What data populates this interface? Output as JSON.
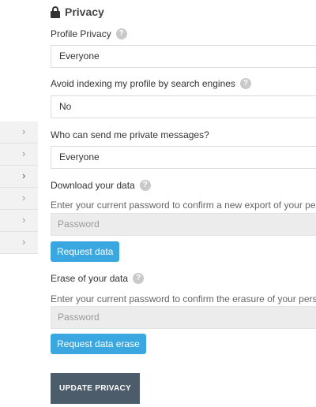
{
  "section": {
    "title": "Privacy",
    "icon": "lock-icon"
  },
  "profile_privacy": {
    "label": "Profile Privacy",
    "value": "Everyone"
  },
  "avoid_indexing": {
    "label": "Avoid indexing my profile by search engines",
    "value": "No"
  },
  "private_messages": {
    "label": "Who can send me private messages?",
    "value": "Everyone"
  },
  "download_data": {
    "label": "Download your data",
    "hint": "Enter your current password to confirm a new export of your personal data.",
    "password_placeholder": "Password",
    "button": "Request data"
  },
  "erase_data": {
    "label": "Erase of your data",
    "hint": "Enter your current password to confirm the erasure of your personal data.",
    "password_placeholder": "Password",
    "button": "Request data erase"
  },
  "update_button": "UPDATE PRIVACY",
  "help_glyph": "?",
  "colors": {
    "accent": "#3aa7e0",
    "update_button": "#4c5c6b",
    "input_disabled": "#ececec"
  }
}
